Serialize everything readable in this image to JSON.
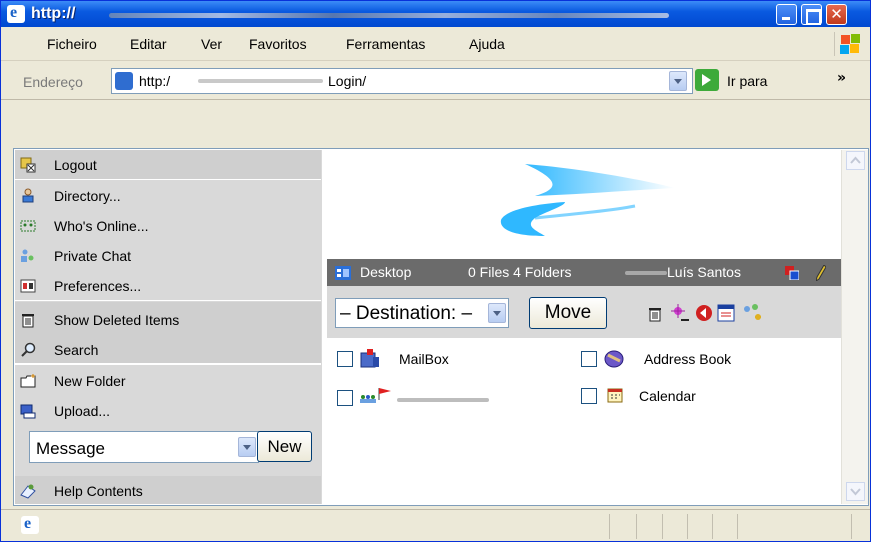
{
  "window": {
    "title": "http://"
  },
  "menubar": {
    "items": [
      "Ficheiro",
      "Editar",
      "Ver",
      "Favoritos",
      "Ferramentas",
      "Ajuda"
    ]
  },
  "addressbar": {
    "label": "Endereço",
    "url_prefix": "http:/",
    "url_suffix": "Login/",
    "go_label": "Ir para",
    "more": "»"
  },
  "sidebar": {
    "items": [
      {
        "label": "Logout",
        "icon": "logout-icon"
      },
      {
        "label": "Directory...",
        "icon": "directory-icon"
      },
      {
        "label": "Who's Online...",
        "icon": "who-online-icon"
      },
      {
        "label": "Private Chat",
        "icon": "private-chat-icon"
      },
      {
        "label": "Preferences...",
        "icon": "preferences-icon"
      },
      {
        "label": "Show Deleted Items",
        "icon": "trash-icon"
      },
      {
        "label": "Search",
        "icon": "search-icon"
      },
      {
        "label": "New Folder",
        "icon": "new-folder-icon"
      },
      {
        "label": "Upload...",
        "icon": "upload-icon"
      },
      {
        "label": "Help Contents",
        "icon": "help-icon"
      }
    ],
    "new_select_value": "Message",
    "new_button": "New"
  },
  "main": {
    "toolbar": {
      "location": "Desktop",
      "counts": "0 Files 4 Folders",
      "user": "Luís Santos"
    },
    "destination_value": "– Destination: –",
    "move_button": "Move",
    "items": [
      {
        "label": "MailBox",
        "icon": "mailbox-icon"
      },
      {
        "label": "Address Book",
        "icon": "address-book-icon"
      },
      {
        "label": "",
        "icon": "group-folder-icon"
      },
      {
        "label": "Calendar",
        "icon": "calendar-icon"
      }
    ]
  },
  "colors": {
    "titlebar": "#0a5ae0",
    "sidebar": "#d9d9d9",
    "toolbar": "#6b6b6b",
    "accent": "#2fb8ff"
  }
}
